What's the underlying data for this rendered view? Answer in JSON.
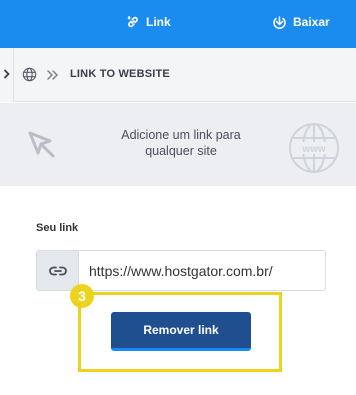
{
  "toolbar": {
    "link_label": "Link",
    "download_label": "Baixar"
  },
  "breadcrumb": {
    "title": "LINK TO WEBSITE"
  },
  "banner": {
    "line1": "Adicione um link para",
    "line2": "qualquer site"
  },
  "form": {
    "label": "Seu link",
    "url_value": "https://www.hostgator.com.br/"
  },
  "highlight": {
    "step": "3"
  },
  "actions": {
    "remove_label": "Remover link"
  },
  "colors": {
    "topbar": "#1a8cf0",
    "button": "#1f4f8f",
    "highlight": "#ecd31d"
  }
}
